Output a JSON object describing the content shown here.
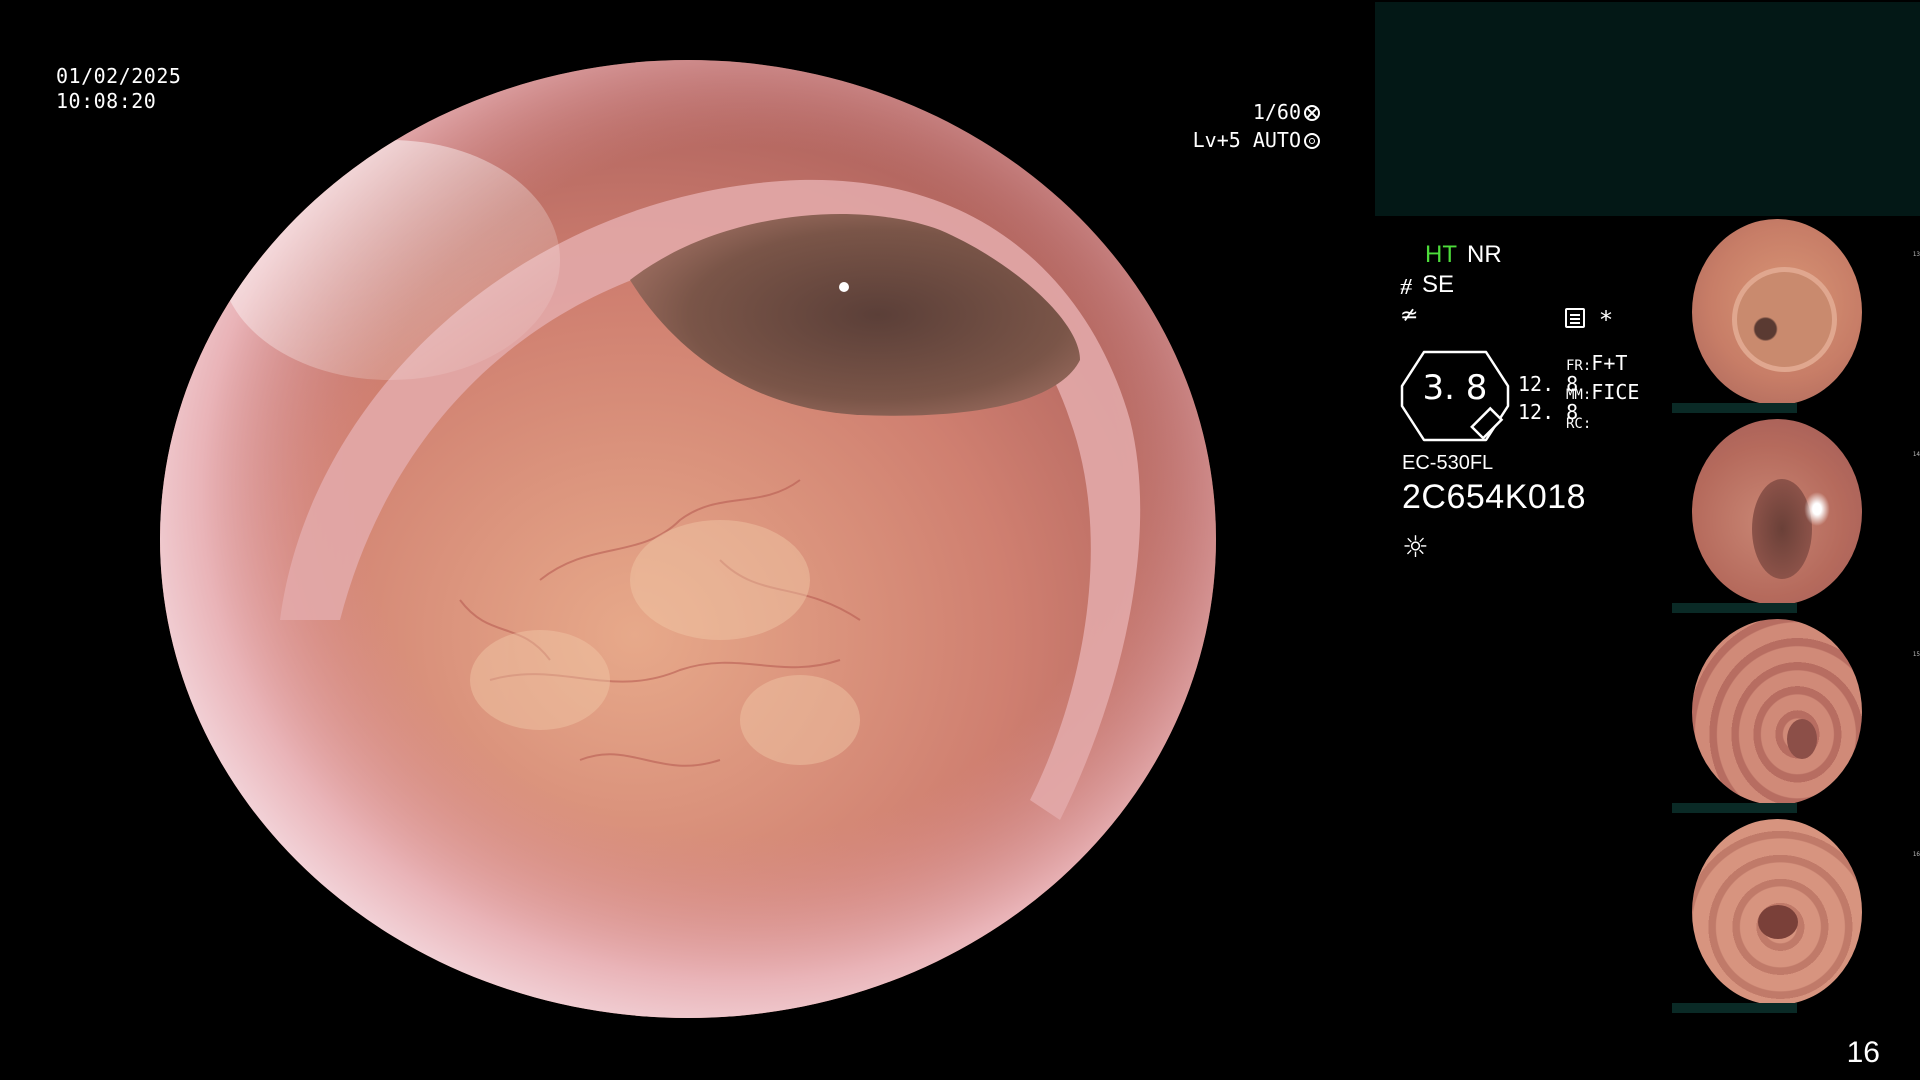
{
  "overlay": {
    "date": "01/02/2025",
    "time": "10:08:20",
    "shutter_speed": "1/60",
    "exposure": "Lv+5",
    "iris_mode": "AUTO",
    "page_number": "16"
  },
  "status": {
    "ht": "HT",
    "nr": "NR",
    "se": "SE",
    "se_icon": "⧣",
    "f_icon": "≄",
    "star": "*"
  },
  "zoom": {
    "level": "3. 8",
    "value1": "12. 8",
    "value2": "12. 8"
  },
  "modes": {
    "fr_key": "FR:",
    "fr_val": "F+T",
    "mm_key": "MM:",
    "mm_val": "FICE",
    "rc_key": "RC:",
    "rc_val": ""
  },
  "scope": {
    "model": "EC-530FL",
    "serial": "2C654K018",
    "lamp_icon": "☼"
  },
  "thumbnails": [
    {
      "label": "captured-image-1",
      "tag": "13"
    },
    {
      "label": "captured-image-2",
      "tag": "14"
    },
    {
      "label": "captured-image-3",
      "tag": "15"
    },
    {
      "label": "captured-image-4",
      "tag": "16"
    }
  ],
  "colors": {
    "ht_green": "#4ddc3b",
    "teal_panel": "#031816",
    "mucosa": "#d98f7e"
  },
  "icons": {
    "shutter": "shutter-icon",
    "aperture": "aperture-icon",
    "menu": "menu-icon",
    "lamp": "lamp-icon",
    "zoom_gauge": "zoom-gauge-icon"
  }
}
